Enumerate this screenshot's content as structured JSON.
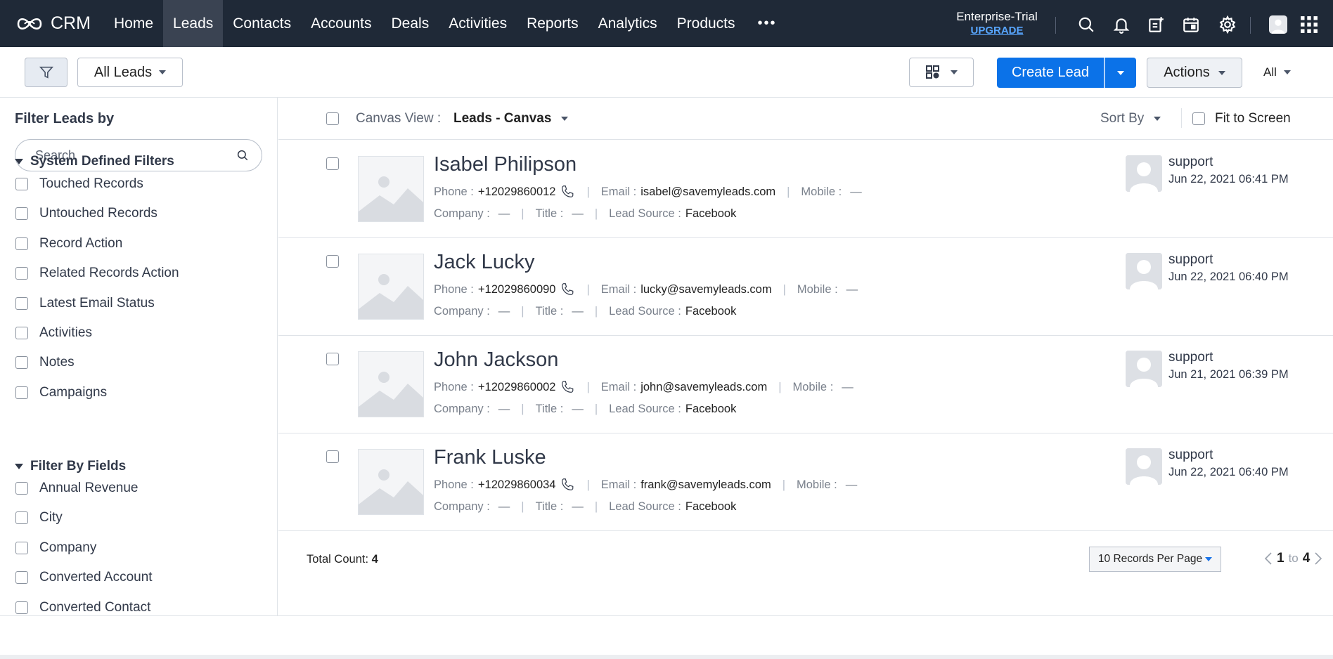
{
  "nav": {
    "brand": "CRM",
    "tabs": [
      {
        "label": "Home"
      },
      {
        "label": "Leads"
      },
      {
        "label": "Contacts"
      },
      {
        "label": "Accounts"
      },
      {
        "label": "Deals"
      },
      {
        "label": "Activities"
      },
      {
        "label": "Reports"
      },
      {
        "label": "Analytics"
      },
      {
        "label": "Products"
      }
    ],
    "active_tab": "Leads",
    "more": "•••",
    "trial_label": "Enterprise-Trial",
    "upgrade_label": "UPGRADE",
    "icons": [
      "search-icon",
      "bell-icon",
      "add-note-icon",
      "calendar-icon",
      "gear-icon",
      "avatar",
      "apps-grid-icon"
    ]
  },
  "toolbar": {
    "view_label": "All Leads",
    "create_label": "Create Lead",
    "actions_label": "Actions",
    "all_label": "All"
  },
  "sidebar": {
    "title": "Filter Leads by",
    "search_placeholder": "Search",
    "system_section": "System Defined Filters",
    "system_filters": [
      {
        "label": "Touched Records"
      },
      {
        "label": "Untouched Records"
      },
      {
        "label": "Record Action"
      },
      {
        "label": "Related Records Action"
      },
      {
        "label": "Latest Email Status"
      },
      {
        "label": "Activities"
      },
      {
        "label": "Notes"
      },
      {
        "label": "Campaigns"
      }
    ],
    "fields_section": "Filter By Fields",
    "field_filters": [
      {
        "label": "Annual Revenue"
      },
      {
        "label": "City"
      },
      {
        "label": "Company"
      },
      {
        "label": "Converted Account"
      },
      {
        "label": "Converted Contact"
      }
    ]
  },
  "canvas": {
    "view_label": "Canvas View :",
    "view_value": "Leads - Canvas",
    "sort_label": "Sort By",
    "fit_label": "Fit to Screen"
  },
  "labels": {
    "phone": "Phone :",
    "email": "Email :",
    "mobile": "Mobile :",
    "company": "Company :",
    "title": "Title :",
    "lead_source": "Lead Source :",
    "empty": "—"
  },
  "leads": [
    {
      "name": "Isabel Philipson",
      "phone": "+12029860012",
      "email": "isabel@savemyleads.com",
      "mobile": "—",
      "company": "—",
      "title": "—",
      "lead_source": "Facebook",
      "owner": "support",
      "time": "Jun 22, 2021 06:41 PM"
    },
    {
      "name": "Jack Lucky",
      "phone": "+12029860090",
      "email": "lucky@savemyleads.com",
      "mobile": "—",
      "company": "—",
      "title": "—",
      "lead_source": "Facebook",
      "owner": "support",
      "time": "Jun 22, 2021 06:40 PM"
    },
    {
      "name": "John Jackson",
      "phone": "+12029860002",
      "email": "john@savemyleads.com",
      "mobile": "—",
      "company": "—",
      "title": "—",
      "lead_source": "Facebook",
      "owner": "support",
      "time": "Jun 21, 2021 06:39 PM"
    },
    {
      "name": "Frank Luske",
      "phone": "+12029860034",
      "email": "frank@savemyleads.com",
      "mobile": "—",
      "company": "—",
      "title": "—",
      "lead_source": "Facebook",
      "owner": "support",
      "time": "Jun 22, 2021 06:40 PM"
    }
  ],
  "footer": {
    "total_label": "Total Count:",
    "total_value": "4",
    "per_page": "10 Records Per Page",
    "page_from": "1",
    "page_to_label": "to",
    "page_to": "4"
  },
  "colors": {
    "nav_bg": "#1f2937",
    "primary": "#0b72e8",
    "upgrade": "#58a6ff"
  }
}
